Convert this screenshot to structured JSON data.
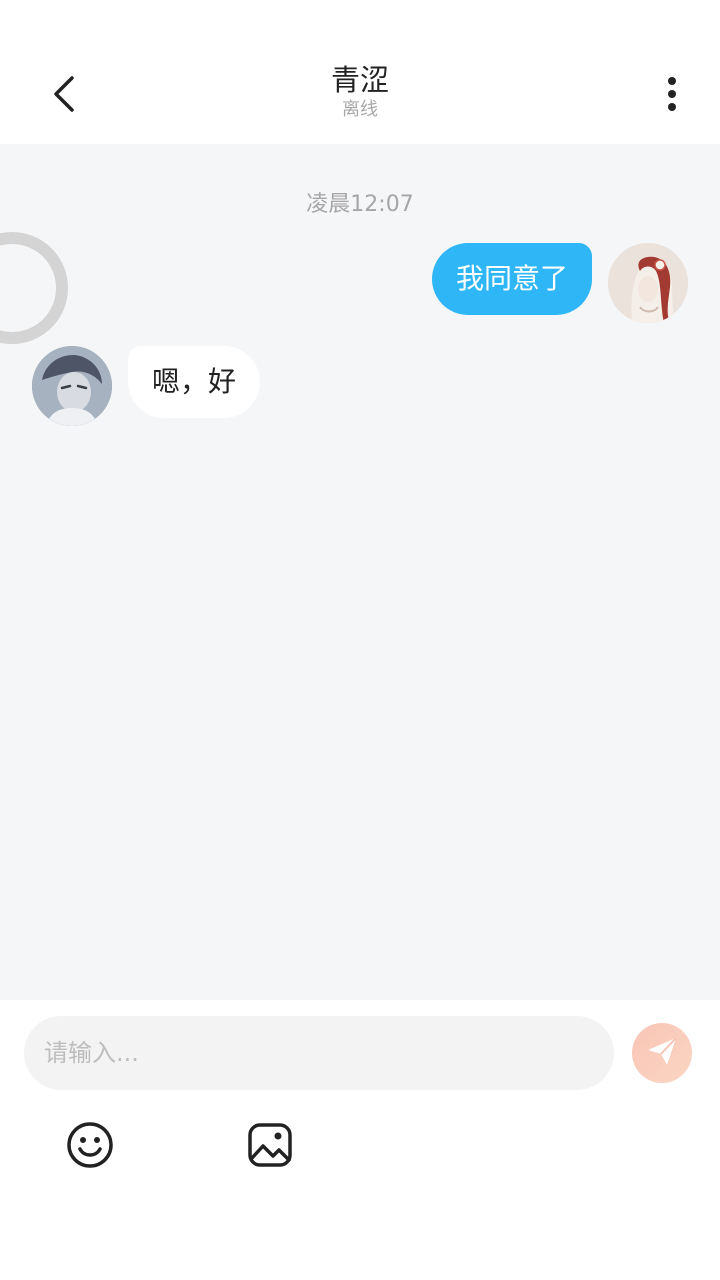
{
  "header": {
    "title": "青涩",
    "status": "离线",
    "back_icon": "chevron-left-icon",
    "more_icon": "more-vertical-icon"
  },
  "chat": {
    "timestamp": "凌晨12:07",
    "messages": [
      {
        "sender": "me",
        "text": "我同意了"
      },
      {
        "sender": "them",
        "text": "嗯，好"
      }
    ]
  },
  "composer": {
    "placeholder": "请输入...",
    "value": "",
    "send_icon": "paper-plane-icon",
    "tools": [
      {
        "icon": "smiley-icon"
      },
      {
        "icon": "image-icon"
      }
    ]
  },
  "colors": {
    "accent": "#2fb6f7",
    "send_button": "#f9c4b5",
    "chat_background": "#f5f6f8"
  }
}
